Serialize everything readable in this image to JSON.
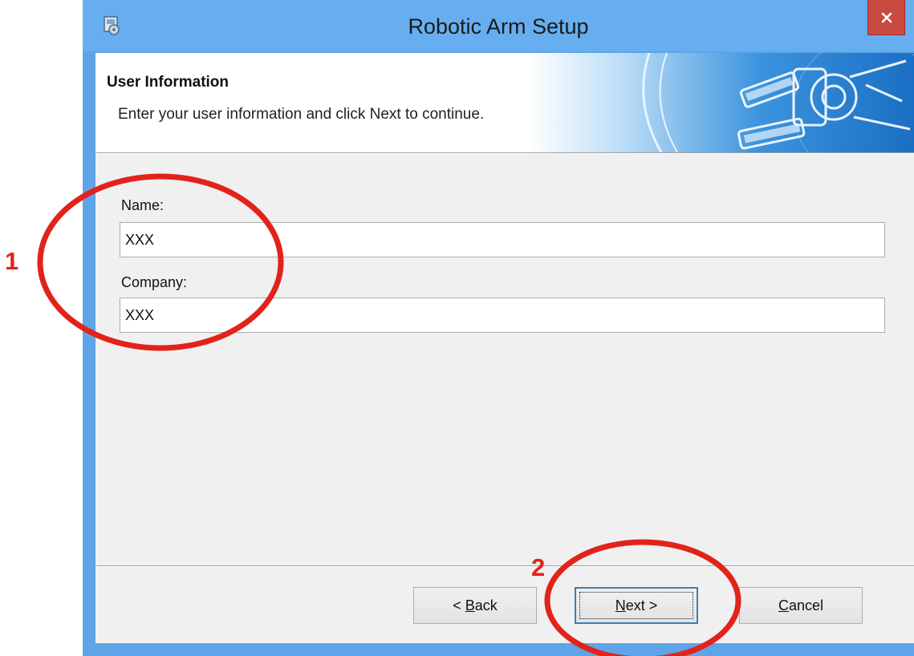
{
  "window": {
    "title": "Robotic Arm Setup"
  },
  "header": {
    "title": "User Information",
    "subtitle": "Enter your user information and click Next to continue."
  },
  "form": {
    "name_label": "Name:",
    "name_value": "XXX",
    "company_label": "Company:",
    "company_value": "XXX"
  },
  "buttons": {
    "back": {
      "accel": "B",
      "rest": "ack",
      "prefix": "< "
    },
    "next": {
      "accel": "N",
      "rest": "ext >"
    },
    "cancel": {
      "accel": "C",
      "rest": "ancel"
    }
  },
  "annotations": {
    "step1": "1",
    "step2": "2",
    "color": "#e2231a"
  },
  "colors": {
    "titlebar": "#67aef0",
    "close": "#c94a41",
    "dialog_bg": "#f0f0f0"
  },
  "icons": {
    "app": "installer-icon",
    "close": "close-icon"
  }
}
